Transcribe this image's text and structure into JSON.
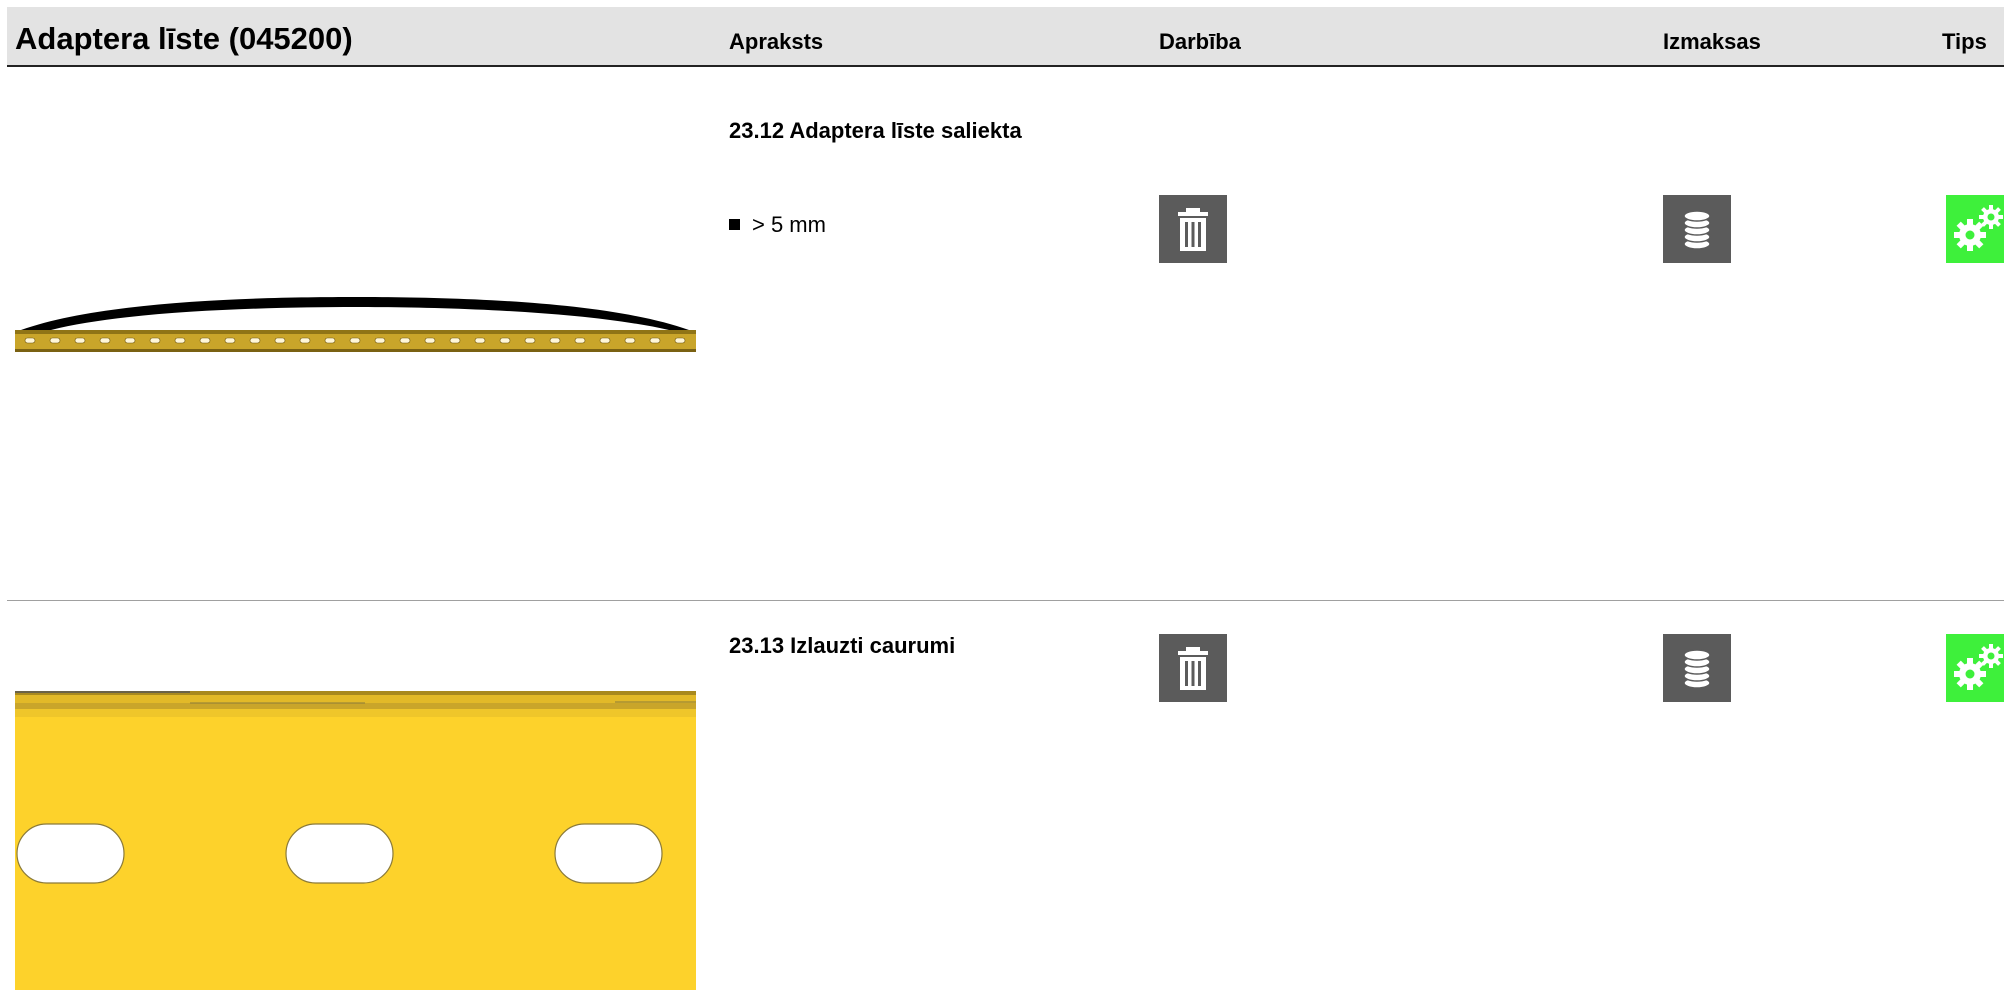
{
  "header": {
    "title": "Adaptera līste (045200)",
    "columns": {
      "description": "Apraksts",
      "action": "Darbība",
      "cost": "Izmaksas",
      "tips": "Tips"
    }
  },
  "rows": [
    {
      "title": "23.12 Adaptera līste saliekta",
      "bullet": "> 5 mm",
      "image_icon": "bent-rail-illustration",
      "delete_icon": "trash-icon",
      "cost_icon": "coins-icon",
      "tips_icon": "gears-icon"
    },
    {
      "title": "23.13 Izlauzti caurumi",
      "image_icon": "rail-holes-illustration",
      "delete_icon": "trash-icon",
      "cost_icon": "coins-icon",
      "tips_icon": "gears-icon"
    }
  ],
  "colors": {
    "header_bg": "#e3e3e3",
    "icon_button_bg": "#5b5b5b",
    "tips_button_bg": "#3ef03b",
    "rail_yellow": "#fdd22b"
  }
}
